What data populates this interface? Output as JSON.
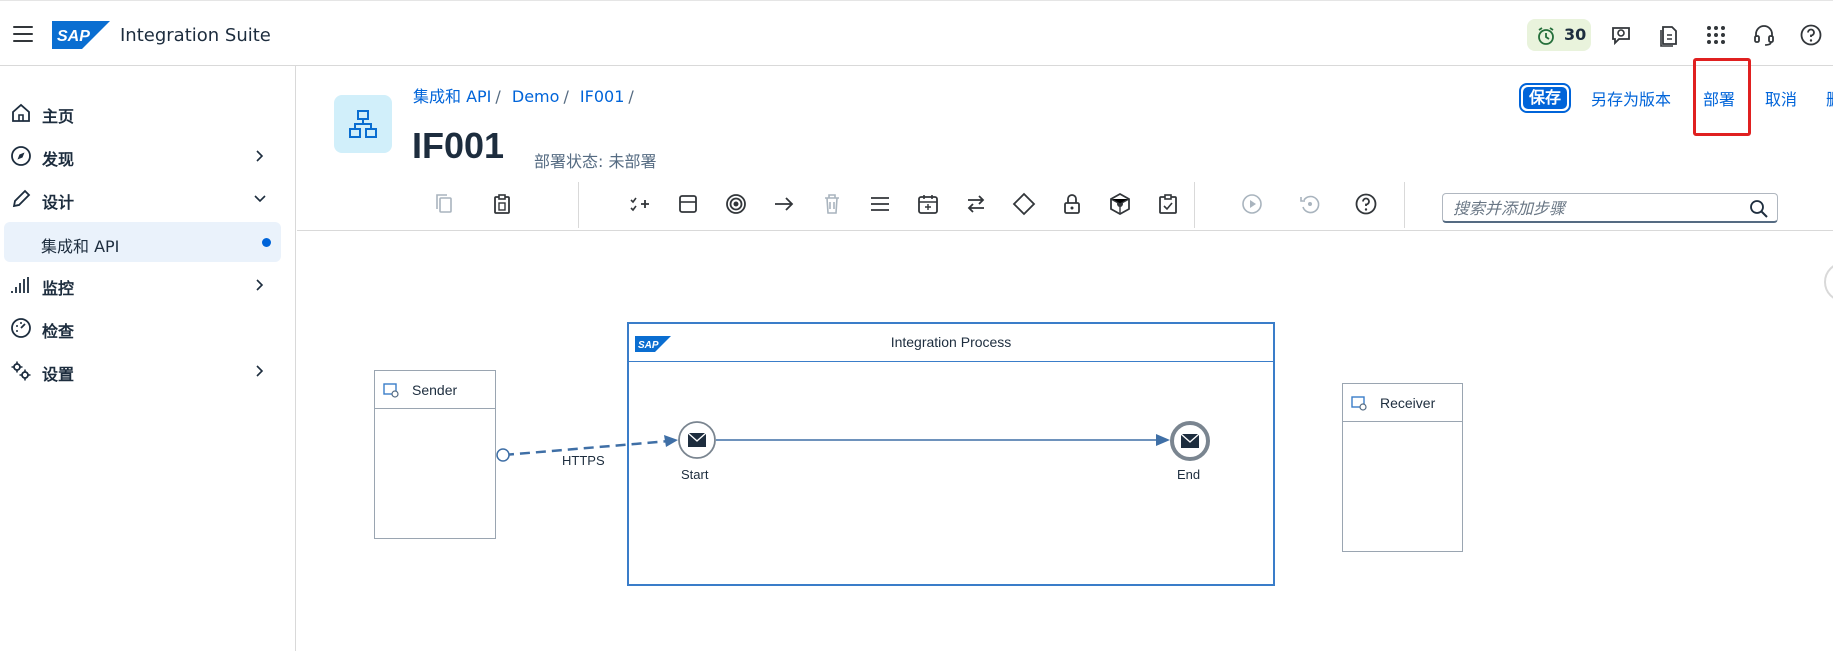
{
  "shell": {
    "product_title": "Integration Suite",
    "notification_count": "30"
  },
  "sidebar": {
    "items": [
      {
        "label": "主页",
        "icon": "home-icon"
      },
      {
        "label": "发现",
        "icon": "compass-icon"
      },
      {
        "label": "设计",
        "icon": "pencil-icon"
      },
      {
        "label": "监控",
        "icon": "bar-chart-icon"
      },
      {
        "label": "检查",
        "icon": "gauge-icon"
      },
      {
        "label": "设置",
        "icon": "gears-icon"
      }
    ],
    "sub_item": {
      "label": "集成和 API"
    }
  },
  "header": {
    "breadcrumb": [
      "集成和 API",
      "Demo",
      "IF001"
    ],
    "breadcrumb_sep": "/",
    "title": "IF001",
    "deploy_status": "部署状态: 未部署",
    "actions": {
      "save": "保存",
      "save_as_version": "另存为版本",
      "deploy": "部署",
      "cancel": "取消",
      "more": "删"
    }
  },
  "toolbar": {
    "search_placeholder": "搜索并添加步骤"
  },
  "diagram": {
    "sender_label": "Sender",
    "receiver_label": "Receiver",
    "process_label": "Integration Process",
    "start_label": "Start",
    "end_label": "End",
    "connection_label": "HTTPS"
  },
  "colors": {
    "accent": "#0064d9",
    "highlight": "#e02020",
    "process_border": "#3a7dc9",
    "badge_bg": "#e9f3dc"
  }
}
